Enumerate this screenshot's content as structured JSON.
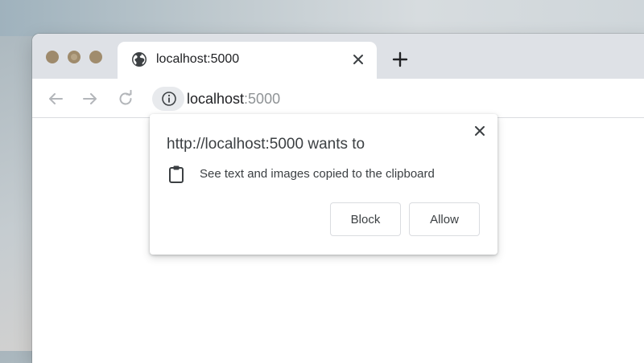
{
  "browser": {
    "tab": {
      "title": "localhost:5000",
      "icon": "globe-icon"
    },
    "toolbar": {
      "url_host": "localhost",
      "url_port": ":5000"
    }
  },
  "permission_popup": {
    "title": "http://localhost:5000 wants to",
    "permission_text": "See text and images copied to the clipboard",
    "permission_icon": "clipboard-icon",
    "block_label": "Block",
    "allow_label": "Allow"
  },
  "colors": {
    "tabstrip": "#dee1e6",
    "traffic_lights": "#9e8a6c",
    "text": "#3c4043",
    "url_port": "#8f9396"
  }
}
